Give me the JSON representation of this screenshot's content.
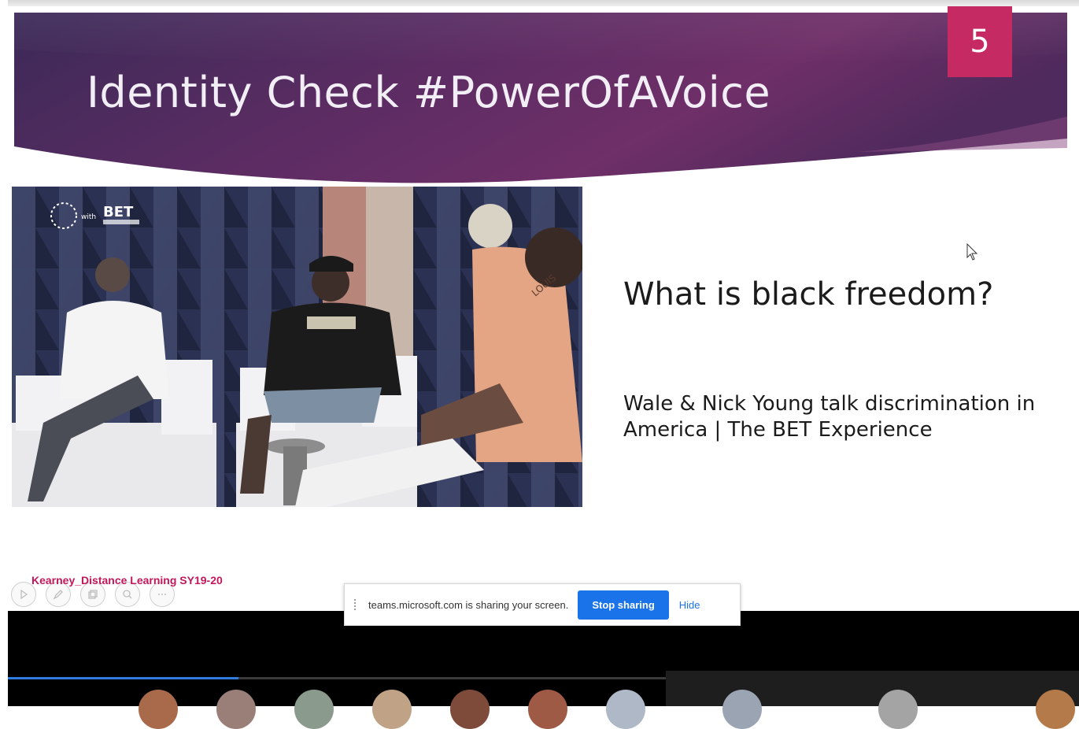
{
  "slide": {
    "title": "Identity Check  #PowerOfAVoice",
    "number": "5",
    "question": "What is black freedom?",
    "caption": "Wale & Nick Young talk discrimination in America | The BET Experience",
    "footer": "Kearney_Distance Learning SY19-20",
    "video_logo": "BET",
    "video_logo_sub": "with",
    "shirt_text": "LOUIS",
    "controls": [
      "play-icon",
      "pen-icon",
      "copy-icon",
      "zoom-icon",
      "more-icon"
    ]
  },
  "share_bar": {
    "message": "teams.microsoft.com is sharing your screen.",
    "stop_label": "Stop sharing",
    "hide_label": "Hide"
  },
  "player": {
    "progress": 0.215
  },
  "colors": {
    "banner_dark": "#3a2552",
    "banner_mid": "#6a2e66",
    "accent": "#c52a63",
    "footer_text": "#c2185b",
    "stop_button": "#1a73e8"
  }
}
